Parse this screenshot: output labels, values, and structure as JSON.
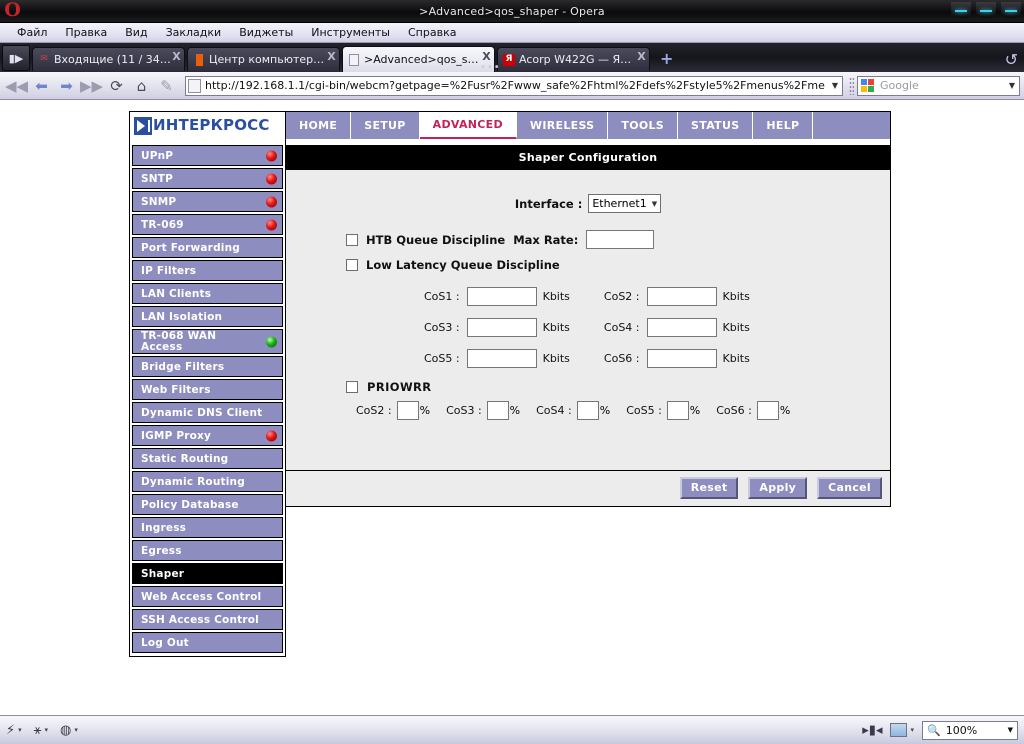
{
  "window": {
    "title": ">Advanced>qos_shaper - Opera",
    "logo": "opera-logo",
    "buttons": [
      "minimize",
      "maximize",
      "close"
    ]
  },
  "menubar": {
    "items": [
      "Файл",
      "Правка",
      "Вид",
      "Закладки",
      "Виджеты",
      "Инструменты",
      "Справка"
    ]
  },
  "tabbar": {
    "panel_toggle": "▮▶",
    "new_tab_label": "+",
    "trash_label": "↺",
    "tabs": [
      {
        "title": "Входящие (11 / 34) — ...",
        "favicon": "mail-icon",
        "close": "X",
        "active": false
      },
      {
        "title": "Центр компьютерной п...",
        "favicon": "orange-bar-icon",
        "close": "X",
        "active": false
      },
      {
        "title": ">Advanced>qos_shaper",
        "favicon": "document-icon",
        "close": "X",
        "active": true
      },
      {
        "title": "Acorp W422G — Яндекс...",
        "favicon": "yandex-icon",
        "close": "X",
        "active": false
      }
    ]
  },
  "navbar": {
    "back": "◀◀",
    "previous": "⬅",
    "forward": "➡",
    "fast_forward": "▶▶",
    "reload": "⟳",
    "home": "⌂",
    "edit": "✎",
    "url": "http://192.168.1.1/cgi-bin/webcm?getpage=%2Fusr%2Fwww_safe%2Fhtml%2Fdefs%2Fstyle5%2Fmenus%2Fme",
    "url_dropdown": "▼",
    "search_placeholder": "Google",
    "search_dropdown": "▼"
  },
  "router": {
    "brand": "ИНТЕРКРОСС",
    "nav_tabs": [
      {
        "label": "HOME",
        "active": false
      },
      {
        "label": "SETUP",
        "active": false
      },
      {
        "label": "ADVANCED",
        "active": true
      },
      {
        "label": "WIRELESS",
        "active": false
      },
      {
        "label": "TOOLS",
        "active": false
      },
      {
        "label": "STATUS",
        "active": false
      },
      {
        "label": "HELP",
        "active": false
      }
    ],
    "sidebar": [
      {
        "label": "UPnP",
        "led": "red",
        "active": false
      },
      {
        "label": "SNTP",
        "led": "red",
        "active": false
      },
      {
        "label": "SNMP",
        "led": "red",
        "active": false
      },
      {
        "label": "TR-069",
        "led": "red",
        "active": false
      },
      {
        "label": "Port Forwarding",
        "led": "none",
        "active": false
      },
      {
        "label": "IP Filters",
        "led": "none",
        "active": false
      },
      {
        "label": "LAN Clients",
        "led": "none",
        "active": false
      },
      {
        "label": "LAN Isolation",
        "led": "none",
        "active": false
      },
      {
        "label": "TR-068 WAN\nAccess",
        "led": "green",
        "active": false,
        "tall": true
      },
      {
        "label": "Bridge Filters",
        "led": "none",
        "active": false
      },
      {
        "label": "Web Filters",
        "led": "none",
        "active": false
      },
      {
        "label": "Dynamic DNS Client",
        "led": "none",
        "active": false
      },
      {
        "label": "IGMP Proxy",
        "led": "red",
        "active": false
      },
      {
        "label": "Static Routing",
        "led": "none",
        "active": false
      },
      {
        "label": "Dynamic Routing",
        "led": "none",
        "active": false
      },
      {
        "label": "Policy Database",
        "led": "none",
        "active": false
      },
      {
        "label": "Ingress",
        "led": "none",
        "active": false
      },
      {
        "label": "Egress",
        "led": "none",
        "active": false
      },
      {
        "label": "Shaper",
        "led": "none",
        "active": true
      },
      {
        "label": "Web Access Control",
        "led": "none",
        "active": false
      },
      {
        "label": "SSH Access Control",
        "led": "none",
        "active": false
      },
      {
        "label": "Log Out",
        "led": "none",
        "active": false
      }
    ],
    "page_title": "Shaper Configuration",
    "form": {
      "interface_label": "Interface :",
      "interface_value": "Ethernet1",
      "interface_arrow": "▼",
      "htb_label": "HTB Queue Discipline",
      "htb_checked": false,
      "max_rate_label": "Max Rate:",
      "max_rate_value": "",
      "lowlatency_label": "Low Latency Queue Discipline",
      "lowlatency_checked": false,
      "kbits_unit": "Kbits",
      "cos_rates": [
        {
          "label": "CoS1 :",
          "value": ""
        },
        {
          "label": "CoS2 :",
          "value": ""
        },
        {
          "label": "CoS3 :",
          "value": ""
        },
        {
          "label": "CoS4 :",
          "value": ""
        },
        {
          "label": "CoS5 :",
          "value": ""
        },
        {
          "label": "CoS6 :",
          "value": ""
        }
      ],
      "priowrr_label": "PRIOWRR",
      "priowrr_checked": false,
      "percent_sign": "%",
      "priowrr_fields": [
        {
          "label": "CoS2 :",
          "value": ""
        },
        {
          "label": "CoS3 :",
          "value": ""
        },
        {
          "label": "CoS4 :",
          "value": ""
        },
        {
          "label": "CoS5 :",
          "value": ""
        },
        {
          "label": "CoS6 :",
          "value": ""
        }
      ]
    },
    "buttons": {
      "reset": "Reset",
      "apply": "Apply",
      "cancel": "Cancel"
    }
  },
  "statusbar": {
    "left_icons": [
      "transfers-icon",
      "history-icon",
      "panels-icon"
    ],
    "caret": "▾",
    "image_mode_icon": "image-icon",
    "fit_icon": "fit-width-icon",
    "zoom_icon": "magnifier-icon",
    "zoom_value": "100%",
    "zoom_dropdown": "▼"
  }
}
